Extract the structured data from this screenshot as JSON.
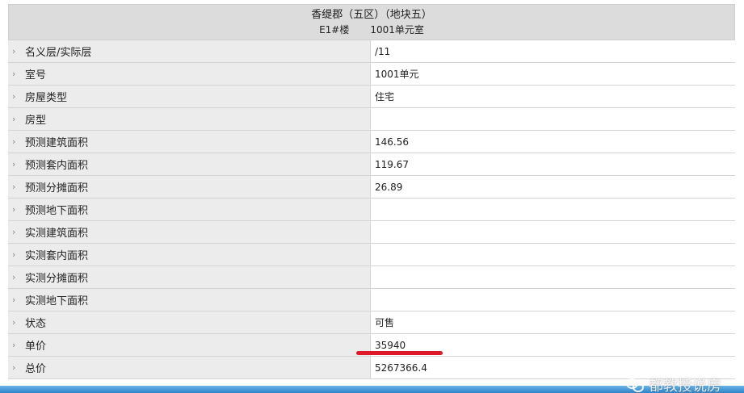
{
  "header": {
    "title": "香缇郡（五区）（地块五）",
    "building": "E1#楼",
    "unit": "1001单元室"
  },
  "rows": [
    {
      "label": "名义层/实际层",
      "value": "/11"
    },
    {
      "label": "室号",
      "value": "1001单元"
    },
    {
      "label": "房屋类型",
      "value": "住宅"
    },
    {
      "label": "房型",
      "value": ""
    },
    {
      "label": "预测建筑面积",
      "value": "146.56"
    },
    {
      "label": "预测套内面积",
      "value": "119.67"
    },
    {
      "label": "预测分摊面积",
      "value": "26.89"
    },
    {
      "label": "预测地下面积",
      "value": ""
    },
    {
      "label": "实测建筑面积",
      "value": ""
    },
    {
      "label": "实测套内面积",
      "value": ""
    },
    {
      "label": "实测分摊面积",
      "value": ""
    },
    {
      "label": "实测地下面积",
      "value": ""
    },
    {
      "label": "状态",
      "value": "可售"
    },
    {
      "label": "单价",
      "value": "35940"
    },
    {
      "label": "总价",
      "value": "5267366.4"
    }
  ],
  "chevron": "›",
  "watermark": {
    "text": "都教授说房",
    "icon": "wechat-icon"
  },
  "colors": {
    "header_bg": "#dcdcdc",
    "label_bg": "#ececec",
    "highlight_underline": "#e0192a",
    "bottom_bar": "#2f84c9"
  }
}
